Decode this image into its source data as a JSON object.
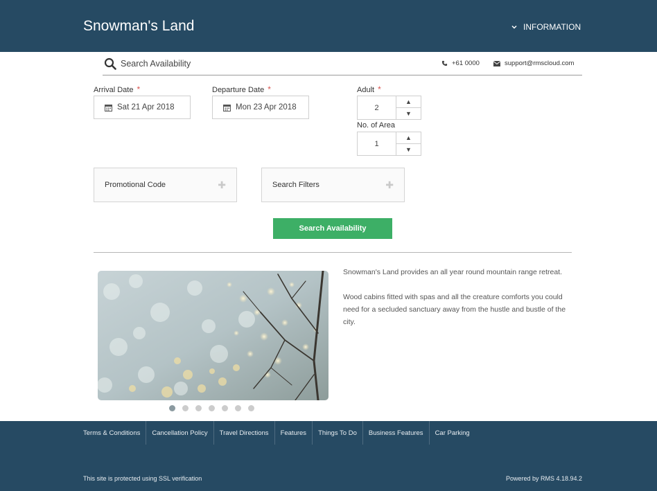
{
  "header": {
    "brand": "Snowman's Land",
    "info_menu_label": "INFORMATION"
  },
  "searchbar": {
    "title": "Search Availability",
    "phone": "+61 0000",
    "email": "support@rmscloud.com"
  },
  "form": {
    "arrival_label": "Arrival Date",
    "arrival_value": "Sat 21 Apr 2018",
    "departure_label": "Departure Date",
    "departure_value": "Mon 23 Apr 2018",
    "required_mark": "*",
    "adult_label": "Adult",
    "adult_value": "2",
    "area_label": "No. of Area",
    "area_value": "1",
    "promo_label": "Promotional Code",
    "filters_label": "Search Filters",
    "search_button": "Search Availability"
  },
  "gallery": {
    "slide_count": 7,
    "active_slide": 1
  },
  "description": {
    "paragraphs": [
      "Snowman's Land provides an all year round mountain range retreat.",
      "Wood cabins fitted with spas and all the creature comforts you could need for a secluded sanctuary away from the hustle and bustle of the city."
    ]
  },
  "footer": {
    "links": [
      "Terms & Conditions",
      "Cancellation Policy",
      "Travel Directions",
      "Features",
      "Things To Do",
      "Business Features",
      "Car Parking"
    ],
    "ssl_text": "This site is protected using SSL verification",
    "powered_text": "Powered by RMS 4.18.94.2"
  },
  "colors": {
    "header_bg": "#264a63",
    "accent_green": "#3daf66",
    "required_red": "#d9534f"
  }
}
